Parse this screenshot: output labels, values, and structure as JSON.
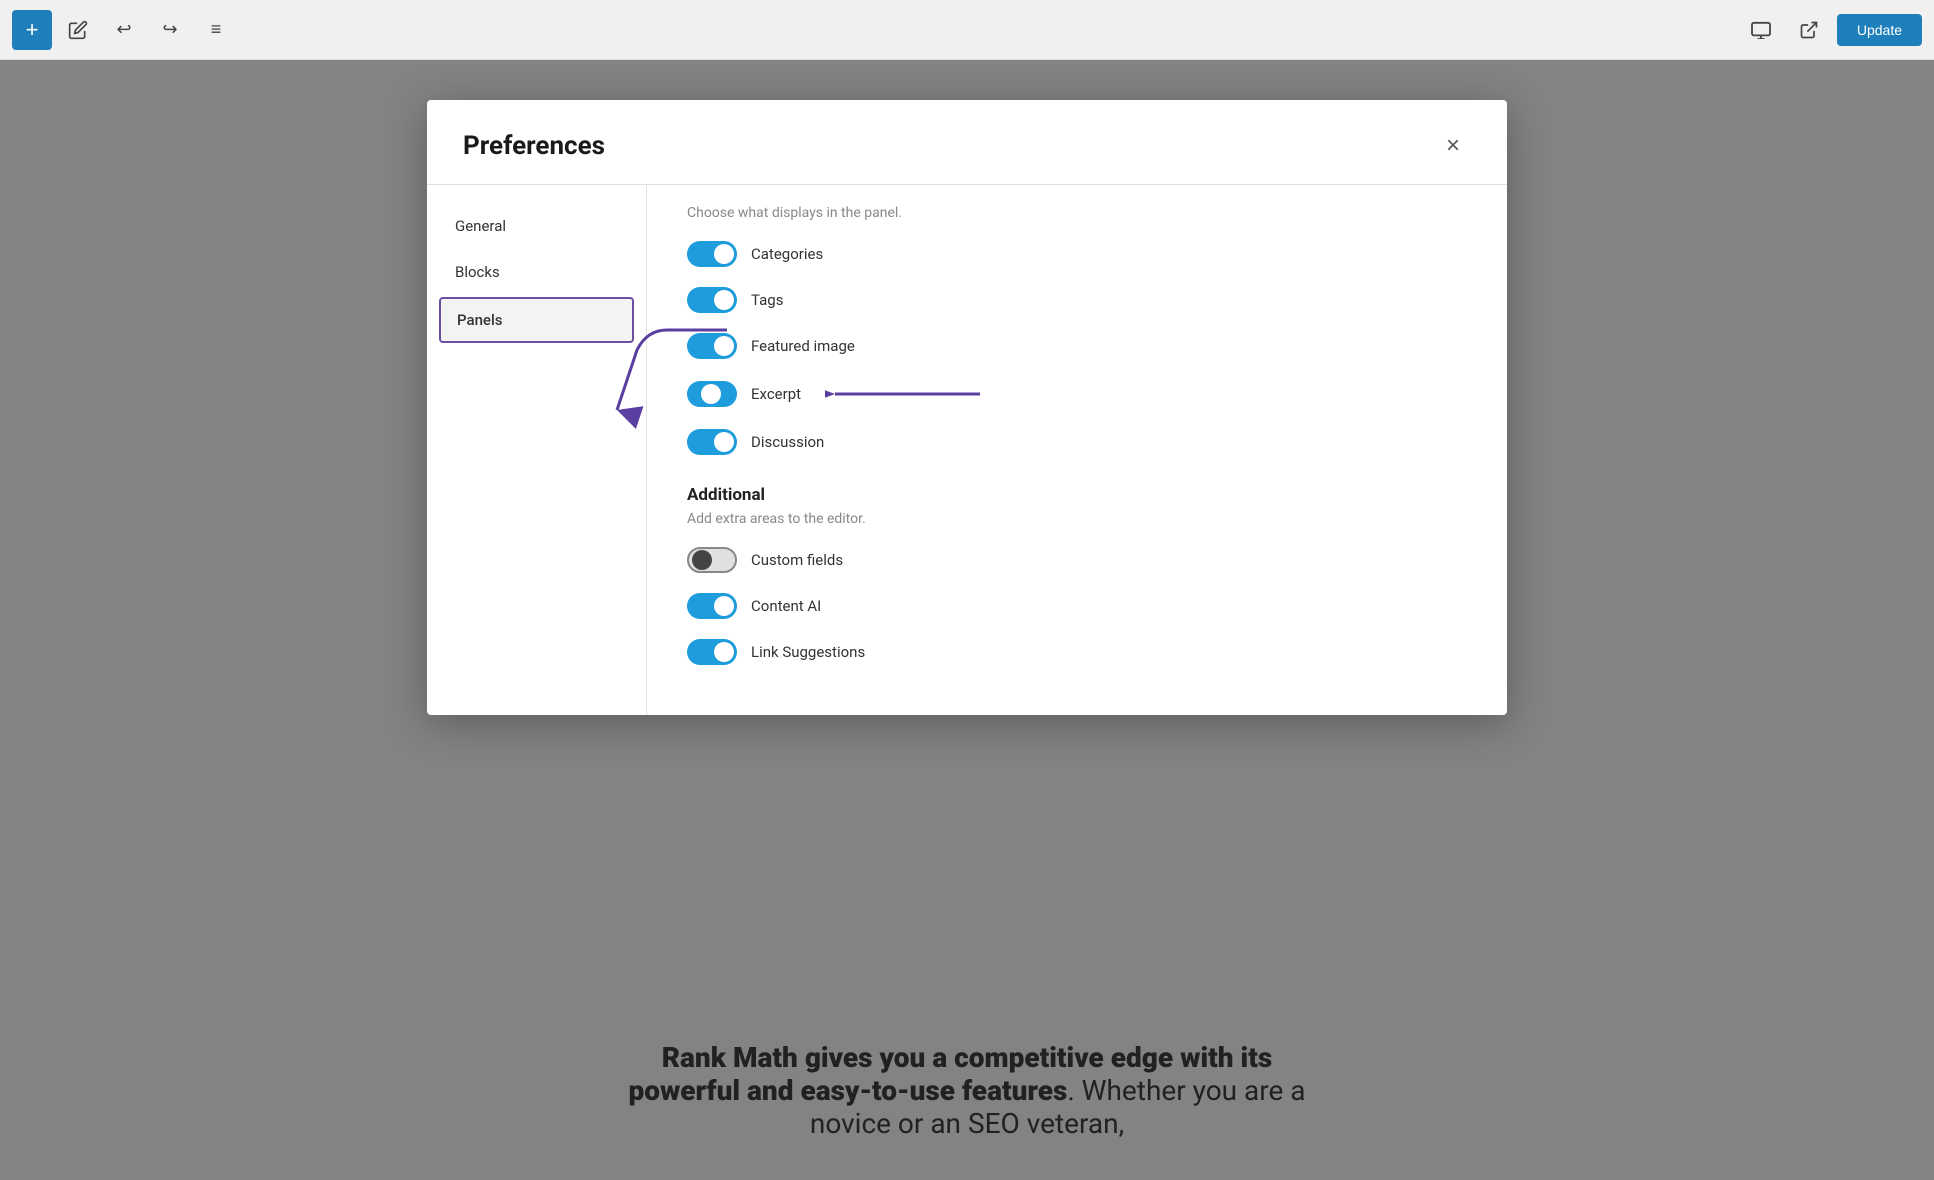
{
  "toolbar": {
    "add_label": "+",
    "undo_label": "↩",
    "redo_label": "↪",
    "menu_label": "≡",
    "preview_label": "⬜",
    "external_label": "⬡",
    "update_label": "Update"
  },
  "modal": {
    "title": "Preferences",
    "close_label": "×",
    "sidebar": {
      "items": [
        {
          "id": "general",
          "label": "General",
          "active": false
        },
        {
          "id": "blocks",
          "label": "Blocks",
          "active": false
        },
        {
          "id": "panels",
          "label": "Panels",
          "active": true
        }
      ]
    },
    "panels_section": {
      "subtitle": "Choose what displays in the panel.",
      "toggles": [
        {
          "id": "categories",
          "label": "Categories",
          "state": "on"
        },
        {
          "id": "tags",
          "label": "Tags",
          "state": "on"
        },
        {
          "id": "featured_image",
          "label": "Featured image",
          "state": "on"
        },
        {
          "id": "excerpt",
          "label": "Excerpt",
          "state": "half"
        },
        {
          "id": "discussion",
          "label": "Discussion",
          "state": "on"
        }
      ],
      "additional": {
        "heading": "Additional",
        "desc": "Add extra areas to the editor.",
        "toggles": [
          {
            "id": "custom_fields",
            "label": "Custom fields",
            "state": "off"
          },
          {
            "id": "content_ai",
            "label": "Content AI",
            "state": "on"
          },
          {
            "id": "link_suggestions",
            "label": "Link Suggestions",
            "state": "on"
          }
        ]
      }
    }
  },
  "background_text": {
    "bold_part": "Rank Math gives you a competitive edge with its powerful and easy-to-use features",
    "normal_part": ". Whether you are a novice or an SEO veteran,"
  }
}
